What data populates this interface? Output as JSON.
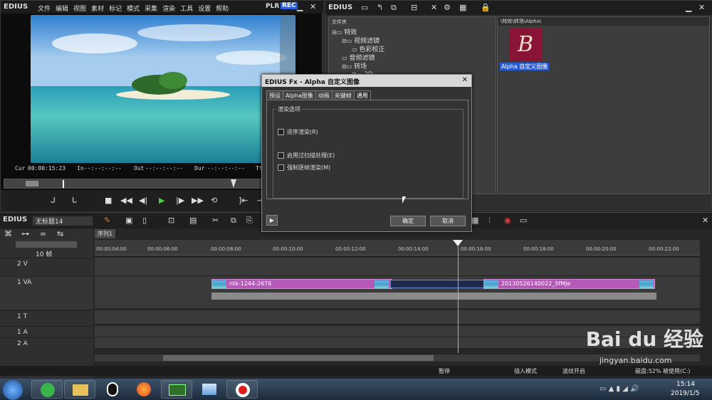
{
  "player": {
    "app_name": "EDIUS",
    "menu": [
      "文件",
      "编辑",
      "视图",
      "素材",
      "标记",
      "模式",
      "采集",
      "渲染",
      "工具",
      "设置",
      "帮助"
    ],
    "plr": "PLR",
    "rec": "REC",
    "cur_label": "Cur",
    "cur_value": "00:00:15:23",
    "in_label": "In",
    "in_value": "--:--:--:--",
    "out_label": "Out",
    "out_value": "--:--:--:--",
    "dur_label": "Dur",
    "dur_value": "--:--:--:--",
    "ttl_label": "Tt"
  },
  "bin": {
    "app_name": "EDIUS",
    "folder_header": "文件夹",
    "tree": [
      "特效",
      "视频滤镜",
      "色彩校正",
      "音频滤镜",
      "转场",
      "2D"
    ],
    "path": "\\特效\\转场\\Alpha\\",
    "item_label": "Alpha 自定义图像",
    "item_letter": "B"
  },
  "dialog": {
    "title": "EDIUS Fx - Alpha 自定义图像",
    "tabs": [
      "预设",
      "Alpha图像",
      "动画",
      "关键帧",
      "通用"
    ],
    "group_label": "渲染选项",
    "options": [
      "逆序渲染(R)",
      "启用过扫描处理(E)",
      "强制逐帧渲染(M)"
    ],
    "ok": "确定",
    "cancel": "取消"
  },
  "timeline": {
    "app_name": "EDIUS",
    "project": "无标题14",
    "sequence_tab": "序列1",
    "zoom": "10 帧",
    "ruler": [
      "00:00:04:00",
      "00:00:06:00",
      "00:00:08:00",
      "00:00:10:00",
      "00:00:12:00",
      "00:00:14:00",
      "00:00:16:00",
      "00:00:18:00",
      "00:00:20:00",
      "00:00:22:00"
    ],
    "tracks": [
      "2 V",
      "1 VA",
      "1 T",
      "1 A",
      "2 A"
    ],
    "clip1": "ntk-1244-2676",
    "clip2": "20130526140022_5fMJe"
  },
  "status": {
    "items": [
      "暂停",
      "插入模式",
      "波纹开启",
      "磁盘:52% 被使用(C:)"
    ]
  },
  "taskbar": {
    "time": "15:14",
    "date": "2019/1/5"
  },
  "watermark": {
    "text": "Bai du 经验",
    "url": "jingyan.baidu.com"
  }
}
